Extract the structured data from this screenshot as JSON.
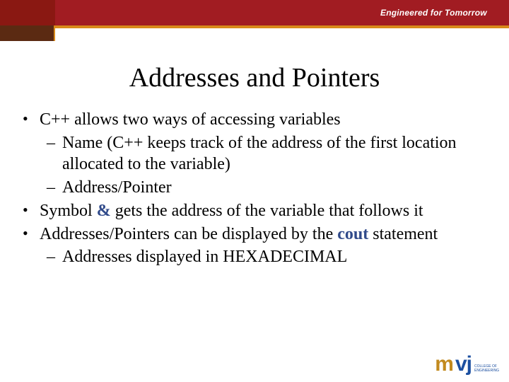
{
  "header": {
    "tagline": "Engineered for Tomorrow"
  },
  "slide": {
    "title": "Addresses and Pointers",
    "bullets": [
      {
        "level": 1,
        "text": "C++ allows two ways of accessing variables"
      },
      {
        "level": 2,
        "text": "Name (C++ keeps track of the address of the first location allocated to the variable)"
      },
      {
        "level": 2,
        "text": "Address/Pointer"
      },
      {
        "level": 1,
        "pre": "Symbol ",
        "strong": "&",
        "post": " gets the address of the variable that follows it",
        "strong_class": "amp"
      },
      {
        "level": 1,
        "pre": "Addresses/Pointers can be displayed by the ",
        "strong": "cout",
        "post": " statement",
        "strong_class": "cout"
      },
      {
        "level": 2,
        "text": "Addresses displayed in HEXADECIMAL"
      }
    ]
  },
  "logo": {
    "m": "m",
    "vj": "vj",
    "sub1": "COLLEGE OF",
    "sub2": "ENGINEERING"
  }
}
